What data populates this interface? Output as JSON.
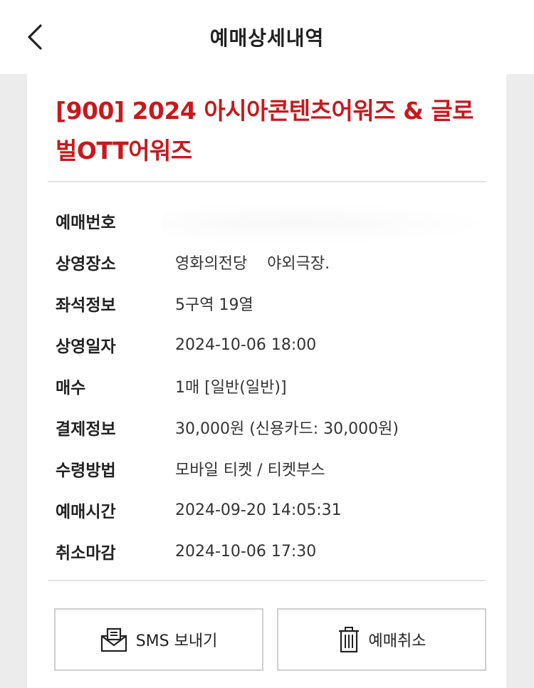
{
  "header": {
    "title": "예매상세내역",
    "back_icon": "chevron-left-icon"
  },
  "event": {
    "title": "[900] 2024 아시아콘텐츠어워즈 & 글로벌OTT어워즈"
  },
  "details": [
    {
      "label": "예매번호",
      "value": ""
    },
    {
      "label": "상영장소",
      "value": "영화의전당    야외극장."
    },
    {
      "label": "좌석정보",
      "value": "5구역 19열"
    },
    {
      "label": "상영일자",
      "value": "2024-10-06 18:00"
    },
    {
      "label": "매수",
      "value": "1매 [일반(일반)]"
    },
    {
      "label": "결제정보",
      "value": "30,000원 (신용카드: 30,000원)"
    },
    {
      "label": "수령방법",
      "value": "모바일 티켓 / 티켓부스"
    },
    {
      "label": "예매시간",
      "value": "2024-09-20 14:05:31"
    },
    {
      "label": "취소마감",
      "value": "2024-10-06 17:30"
    }
  ],
  "actions": {
    "sms_label": "SMS 보내기",
    "sms_icon": "envelope-icon",
    "cancel_label": "예매취소",
    "cancel_icon": "trash-icon"
  },
  "colors": {
    "accent": "#c8191c",
    "background": "#ececec",
    "card": "#ffffff"
  }
}
